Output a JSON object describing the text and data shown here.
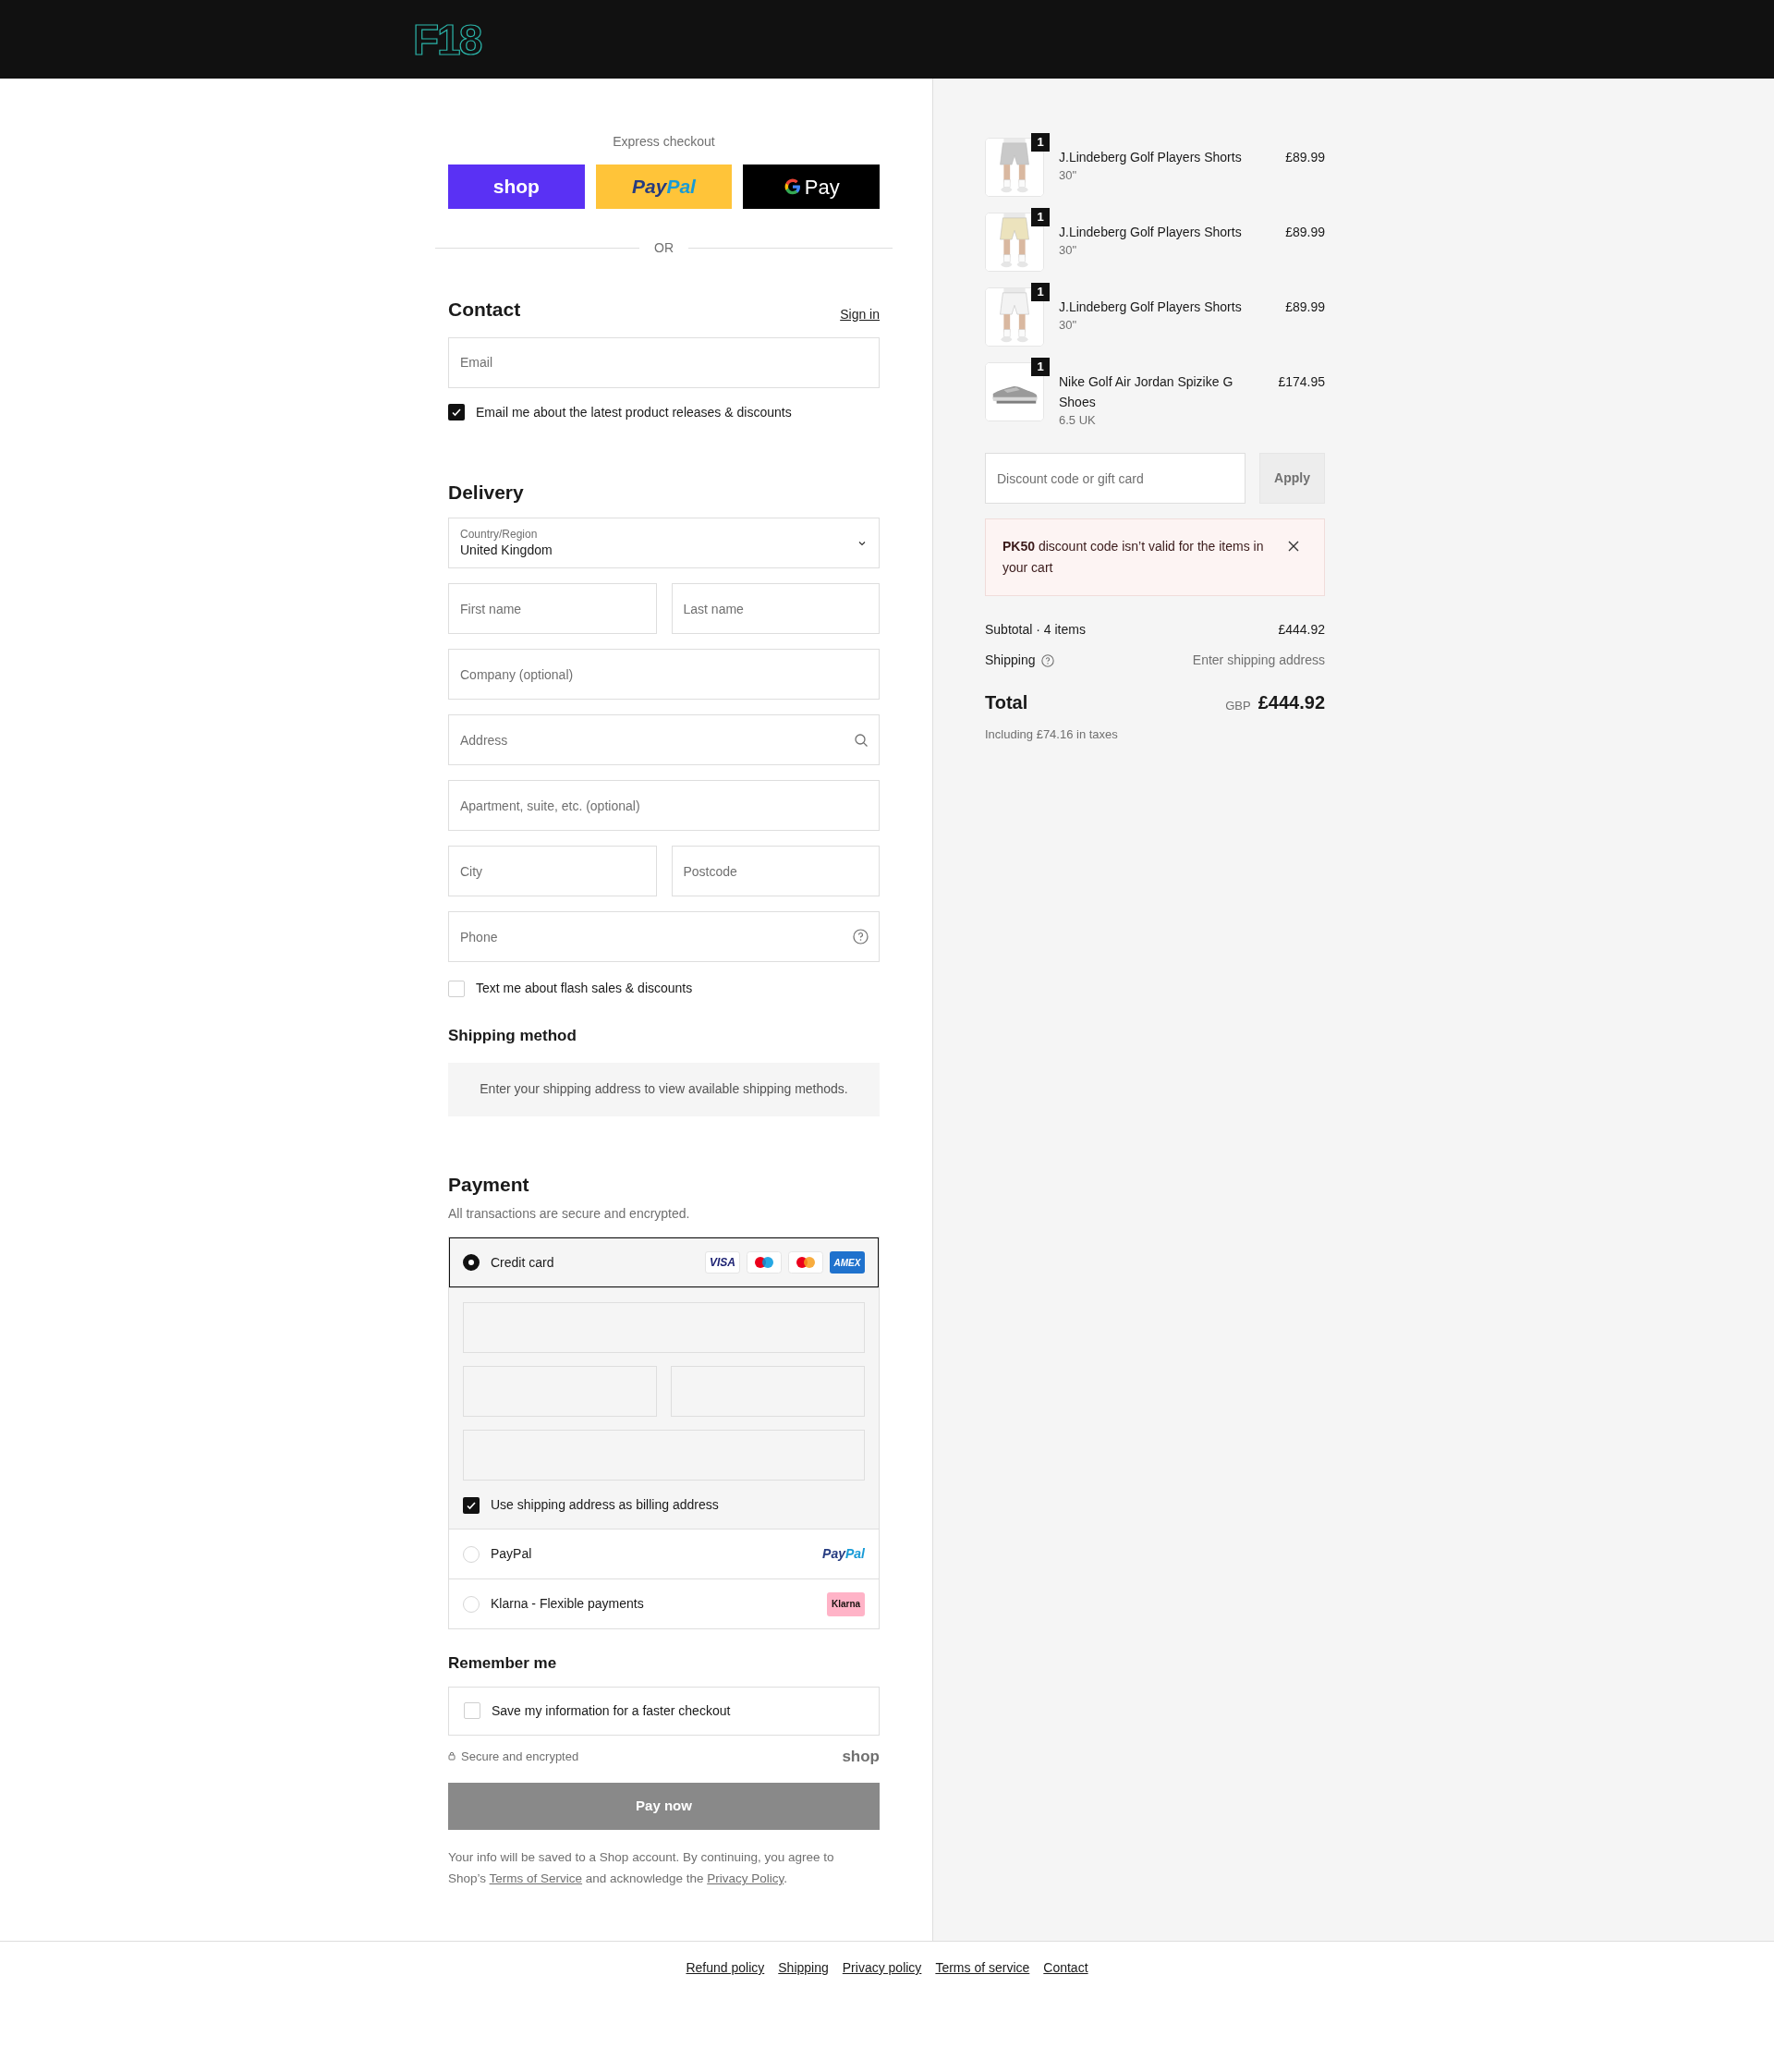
{
  "header": {
    "logo": "F18"
  },
  "express": {
    "title": "Express checkout",
    "buttons": [
      {
        "kind": "shop",
        "label": "shop"
      },
      {
        "kind": "paypal",
        "parts": [
          "Pay",
          "Pal"
        ]
      },
      {
        "kind": "gpay",
        "label": "Pay"
      }
    ],
    "divider": "OR"
  },
  "contact": {
    "title": "Contact",
    "sign_in": "Sign in",
    "email": {
      "placeholder": "Email"
    },
    "newsletter": {
      "label": "Email me about the latest product releases & discounts",
      "checked": true
    }
  },
  "delivery": {
    "title": "Delivery",
    "country": {
      "label": "Country/Region",
      "value": "United Kingdom"
    },
    "rows": [
      [
        {
          "placeholder": "First name"
        },
        {
          "placeholder": "Last name"
        }
      ],
      [
        {
          "placeholder": "Company (optional)"
        }
      ],
      [
        {
          "placeholder": "Address",
          "kind": "search"
        }
      ],
      [
        {
          "placeholder": "Apartment, suite, etc. (optional)"
        }
      ],
      [
        {
          "placeholder": "City"
        },
        {
          "placeholder": "Postcode"
        }
      ],
      [
        {
          "placeholder": "Phone",
          "kind": "help"
        }
      ]
    ],
    "sms": {
      "label": "Text me about flash sales & discounts",
      "checked": false
    }
  },
  "shipping_method": {
    "title": "Shipping method",
    "message": "Enter your shipping address to view available shipping methods."
  },
  "payment": {
    "title": "Payment",
    "subtitle": "All transactions are secure and encrypted.",
    "methods": [
      {
        "kind": "card",
        "label": "Credit card",
        "selected": true,
        "brands": [
          {
            "kind": "visa",
            "label": "VISA"
          },
          {
            "kind": "maestro"
          },
          {
            "kind": "mastercard"
          },
          {
            "kind": "amex",
            "label": "AMEX"
          }
        ],
        "billing": {
          "label": "Use shipping address as billing address",
          "checked": true
        }
      },
      {
        "kind": "paypal",
        "label": "PayPal",
        "selected": false,
        "logo_parts": [
          "Pay",
          "Pal"
        ]
      },
      {
        "kind": "klarna",
        "label": "Klarna - Flexible payments",
        "selected": false,
        "logo": "Klarna"
      }
    ]
  },
  "remember": {
    "title": "Remember me",
    "label": "Save my information for a faster checkout",
    "checked": false
  },
  "secure": {
    "label": "Secure and encrypted",
    "brand": "shop"
  },
  "pay_button": "Pay now",
  "disclaimer": [
    {
      "kind": "text",
      "text": "Your info will be saved to a Shop account. By continuing, you agree to Shop’s "
    },
    {
      "kind": "link",
      "text": "Terms of Service"
    },
    {
      "kind": "text",
      "text": " and acknowledge the "
    },
    {
      "kind": "link",
      "text": "Privacy Policy"
    },
    {
      "kind": "text",
      "text": "."
    }
  ],
  "summary": {
    "items": [
      {
        "kind": "shorts",
        "name": "J.Lindeberg Golf Players Shorts",
        "variant": "30\"",
        "price": "£89.99",
        "quantity": "1"
      },
      {
        "kind": "shorts",
        "name": "J.Lindeberg Golf Players Shorts",
        "variant": "30\"",
        "price": "£89.99",
        "quantity": "1"
      },
      {
        "kind": "shorts",
        "name": "J.Lindeberg Golf Players Shorts",
        "variant": "30\"",
        "price": "£89.99",
        "quantity": "1"
      },
      {
        "kind": "shoe",
        "name": "Nike Golf Air Jordan Spizike G Shoes",
        "variant": "6.5 UK",
        "price": "£174.95",
        "quantity": "1"
      }
    ],
    "discount": {
      "placeholder": "Discount code or gift card",
      "button": "Apply",
      "disabled": true
    },
    "error": "**PK50** discount code isn’t valid for the items in your cart",
    "subtotal": {
      "label": "Subtotal · 4 items",
      "value": "£444.92"
    },
    "shipping": {
      "label": "Shipping",
      "value": "Enter shipping address"
    },
    "total": {
      "label": "Total",
      "currency": "GBP",
      "value": "£444.92"
    },
    "taxes": "Including £74.16 in taxes"
  },
  "footer": [
    "Refund policy",
    "Shipping",
    "Privacy policy",
    "Terms of service",
    "Contact"
  ]
}
